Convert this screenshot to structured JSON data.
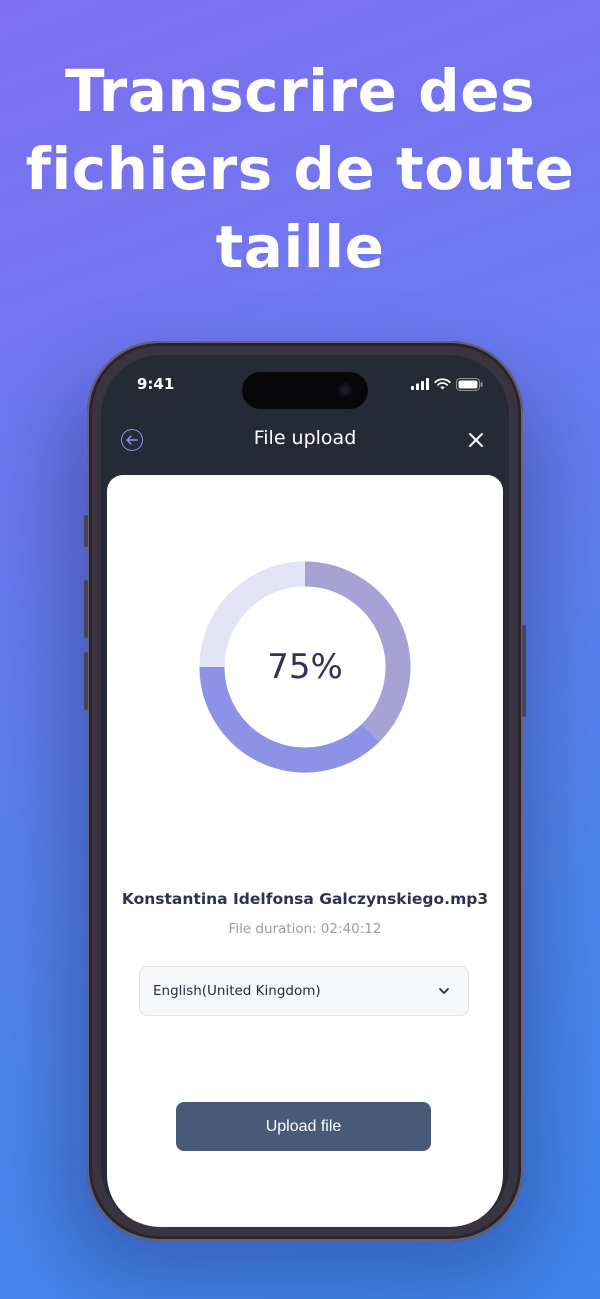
{
  "headline": {
    "line1": "Transcrire des",
    "line2": "fichiers de toute",
    "line3": "taille"
  },
  "status_bar": {
    "time": "9:41",
    "icons": [
      "signal-icon",
      "wifi-icon",
      "battery-icon"
    ]
  },
  "nav": {
    "title": "File upload",
    "back_icon": "back-arrow-circle-icon",
    "close_icon": "close-icon"
  },
  "upload": {
    "progress_percent": 75,
    "progress_label": "75%",
    "file_name": "Konstantina Idelfonsa Galczynskiego.mp3",
    "duration_label": "File duration:",
    "duration_value": "02:40:12",
    "language_selected": "English(United Kingdom)",
    "button_label": "Upload file"
  },
  "colors": {
    "accent": "#8d8ff5",
    "donut_filled_a": "#a7a2d4",
    "donut_filled_b": "#8c92e6",
    "donut_remaining": "#e2e3f5",
    "button": "#475a78",
    "screen_header": "#262a36"
  }
}
